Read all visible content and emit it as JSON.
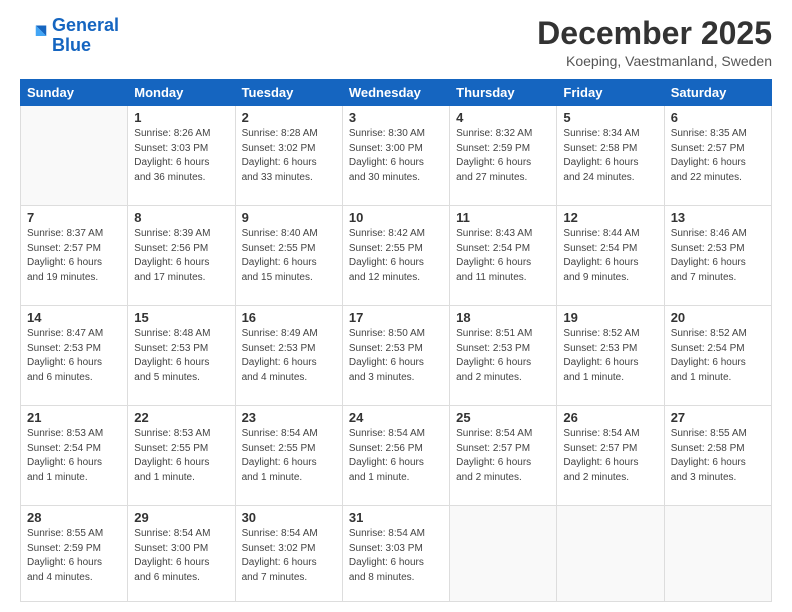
{
  "logo": {
    "line1": "General",
    "line2": "Blue"
  },
  "title": "December 2025",
  "subtitle": "Koeping, Vaestmanland, Sweden",
  "weekdays": [
    "Sunday",
    "Monday",
    "Tuesday",
    "Wednesday",
    "Thursday",
    "Friday",
    "Saturday"
  ],
  "weeks": [
    [
      {
        "day": "",
        "sunrise": "",
        "sunset": "",
        "daylight": ""
      },
      {
        "day": "1",
        "sunrise": "Sunrise: 8:26 AM",
        "sunset": "Sunset: 3:03 PM",
        "daylight": "Daylight: 6 hours and 36 minutes."
      },
      {
        "day": "2",
        "sunrise": "Sunrise: 8:28 AM",
        "sunset": "Sunset: 3:02 PM",
        "daylight": "Daylight: 6 hours and 33 minutes."
      },
      {
        "day": "3",
        "sunrise": "Sunrise: 8:30 AM",
        "sunset": "Sunset: 3:00 PM",
        "daylight": "Daylight: 6 hours and 30 minutes."
      },
      {
        "day": "4",
        "sunrise": "Sunrise: 8:32 AM",
        "sunset": "Sunset: 2:59 PM",
        "daylight": "Daylight: 6 hours and 27 minutes."
      },
      {
        "day": "5",
        "sunrise": "Sunrise: 8:34 AM",
        "sunset": "Sunset: 2:58 PM",
        "daylight": "Daylight: 6 hours and 24 minutes."
      },
      {
        "day": "6",
        "sunrise": "Sunrise: 8:35 AM",
        "sunset": "Sunset: 2:57 PM",
        "daylight": "Daylight: 6 hours and 22 minutes."
      }
    ],
    [
      {
        "day": "7",
        "sunrise": "Sunrise: 8:37 AM",
        "sunset": "Sunset: 2:57 PM",
        "daylight": "Daylight: 6 hours and 19 minutes."
      },
      {
        "day": "8",
        "sunrise": "Sunrise: 8:39 AM",
        "sunset": "Sunset: 2:56 PM",
        "daylight": "Daylight: 6 hours and 17 minutes."
      },
      {
        "day": "9",
        "sunrise": "Sunrise: 8:40 AM",
        "sunset": "Sunset: 2:55 PM",
        "daylight": "Daylight: 6 hours and 15 minutes."
      },
      {
        "day": "10",
        "sunrise": "Sunrise: 8:42 AM",
        "sunset": "Sunset: 2:55 PM",
        "daylight": "Daylight: 6 hours and 12 minutes."
      },
      {
        "day": "11",
        "sunrise": "Sunrise: 8:43 AM",
        "sunset": "Sunset: 2:54 PM",
        "daylight": "Daylight: 6 hours and 11 minutes."
      },
      {
        "day": "12",
        "sunrise": "Sunrise: 8:44 AM",
        "sunset": "Sunset: 2:54 PM",
        "daylight": "Daylight: 6 hours and 9 minutes."
      },
      {
        "day": "13",
        "sunrise": "Sunrise: 8:46 AM",
        "sunset": "Sunset: 2:53 PM",
        "daylight": "Daylight: 6 hours and 7 minutes."
      }
    ],
    [
      {
        "day": "14",
        "sunrise": "Sunrise: 8:47 AM",
        "sunset": "Sunset: 2:53 PM",
        "daylight": "Daylight: 6 hours and 6 minutes."
      },
      {
        "day": "15",
        "sunrise": "Sunrise: 8:48 AM",
        "sunset": "Sunset: 2:53 PM",
        "daylight": "Daylight: 6 hours and 5 minutes."
      },
      {
        "day": "16",
        "sunrise": "Sunrise: 8:49 AM",
        "sunset": "Sunset: 2:53 PM",
        "daylight": "Daylight: 6 hours and 4 minutes."
      },
      {
        "day": "17",
        "sunrise": "Sunrise: 8:50 AM",
        "sunset": "Sunset: 2:53 PM",
        "daylight": "Daylight: 6 hours and 3 minutes."
      },
      {
        "day": "18",
        "sunrise": "Sunrise: 8:51 AM",
        "sunset": "Sunset: 2:53 PM",
        "daylight": "Daylight: 6 hours and 2 minutes."
      },
      {
        "day": "19",
        "sunrise": "Sunrise: 8:52 AM",
        "sunset": "Sunset: 2:53 PM",
        "daylight": "Daylight: 6 hours and 1 minute."
      },
      {
        "day": "20",
        "sunrise": "Sunrise: 8:52 AM",
        "sunset": "Sunset: 2:54 PM",
        "daylight": "Daylight: 6 hours and 1 minute."
      }
    ],
    [
      {
        "day": "21",
        "sunrise": "Sunrise: 8:53 AM",
        "sunset": "Sunset: 2:54 PM",
        "daylight": "Daylight: 6 hours and 1 minute."
      },
      {
        "day": "22",
        "sunrise": "Sunrise: 8:53 AM",
        "sunset": "Sunset: 2:55 PM",
        "daylight": "Daylight: 6 hours and 1 minute."
      },
      {
        "day": "23",
        "sunrise": "Sunrise: 8:54 AM",
        "sunset": "Sunset: 2:55 PM",
        "daylight": "Daylight: 6 hours and 1 minute."
      },
      {
        "day": "24",
        "sunrise": "Sunrise: 8:54 AM",
        "sunset": "Sunset: 2:56 PM",
        "daylight": "Daylight: 6 hours and 1 minute."
      },
      {
        "day": "25",
        "sunrise": "Sunrise: 8:54 AM",
        "sunset": "Sunset: 2:57 PM",
        "daylight": "Daylight: 6 hours and 2 minutes."
      },
      {
        "day": "26",
        "sunrise": "Sunrise: 8:54 AM",
        "sunset": "Sunset: 2:57 PM",
        "daylight": "Daylight: 6 hours and 2 minutes."
      },
      {
        "day": "27",
        "sunrise": "Sunrise: 8:55 AM",
        "sunset": "Sunset: 2:58 PM",
        "daylight": "Daylight: 6 hours and 3 minutes."
      }
    ],
    [
      {
        "day": "28",
        "sunrise": "Sunrise: 8:55 AM",
        "sunset": "Sunset: 2:59 PM",
        "daylight": "Daylight: 6 hours and 4 minutes."
      },
      {
        "day": "29",
        "sunrise": "Sunrise: 8:54 AM",
        "sunset": "Sunset: 3:00 PM",
        "daylight": "Daylight: 6 hours and 6 minutes."
      },
      {
        "day": "30",
        "sunrise": "Sunrise: 8:54 AM",
        "sunset": "Sunset: 3:02 PM",
        "daylight": "Daylight: 6 hours and 7 minutes."
      },
      {
        "day": "31",
        "sunrise": "Sunrise: 8:54 AM",
        "sunset": "Sunset: 3:03 PM",
        "daylight": "Daylight: 6 hours and 8 minutes."
      },
      {
        "day": "",
        "sunrise": "",
        "sunset": "",
        "daylight": ""
      },
      {
        "day": "",
        "sunrise": "",
        "sunset": "",
        "daylight": ""
      },
      {
        "day": "",
        "sunrise": "",
        "sunset": "",
        "daylight": ""
      }
    ]
  ]
}
